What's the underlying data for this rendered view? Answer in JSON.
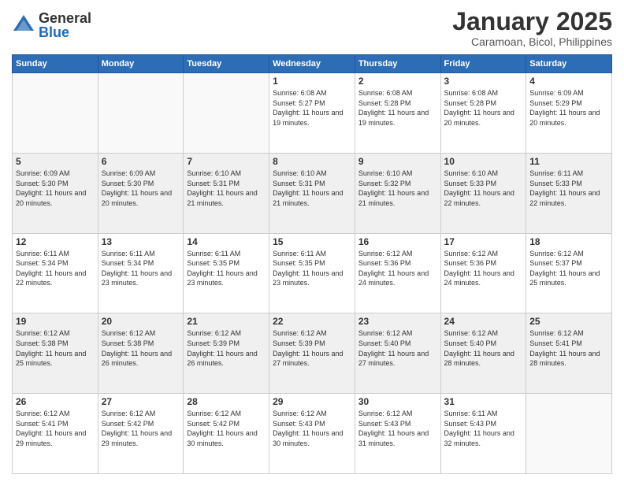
{
  "header": {
    "logo": {
      "line1": "General",
      "line2": "Blue"
    },
    "title": "January 2025",
    "location": "Caramoan, Bicol, Philippines"
  },
  "days_of_week": [
    "Sunday",
    "Monday",
    "Tuesday",
    "Wednesday",
    "Thursday",
    "Friday",
    "Saturday"
  ],
  "weeks": [
    [
      {
        "day": "",
        "sunrise": "",
        "sunset": "",
        "daylight": "",
        "empty": true
      },
      {
        "day": "",
        "sunrise": "",
        "sunset": "",
        "daylight": "",
        "empty": true
      },
      {
        "day": "",
        "sunrise": "",
        "sunset": "",
        "daylight": "",
        "empty": true
      },
      {
        "day": "1",
        "sunrise": "Sunrise: 6:08 AM",
        "sunset": "Sunset: 5:27 PM",
        "daylight": "Daylight: 11 hours and 19 minutes."
      },
      {
        "day": "2",
        "sunrise": "Sunrise: 6:08 AM",
        "sunset": "Sunset: 5:28 PM",
        "daylight": "Daylight: 11 hours and 19 minutes."
      },
      {
        "day": "3",
        "sunrise": "Sunrise: 6:08 AM",
        "sunset": "Sunset: 5:28 PM",
        "daylight": "Daylight: 11 hours and 20 minutes."
      },
      {
        "day": "4",
        "sunrise": "Sunrise: 6:09 AM",
        "sunset": "Sunset: 5:29 PM",
        "daylight": "Daylight: 11 hours and 20 minutes."
      }
    ],
    [
      {
        "day": "5",
        "sunrise": "Sunrise: 6:09 AM",
        "sunset": "Sunset: 5:30 PM",
        "daylight": "Daylight: 11 hours and 20 minutes."
      },
      {
        "day": "6",
        "sunrise": "Sunrise: 6:09 AM",
        "sunset": "Sunset: 5:30 PM",
        "daylight": "Daylight: 11 hours and 20 minutes."
      },
      {
        "day": "7",
        "sunrise": "Sunrise: 6:10 AM",
        "sunset": "Sunset: 5:31 PM",
        "daylight": "Daylight: 11 hours and 21 minutes."
      },
      {
        "day": "8",
        "sunrise": "Sunrise: 6:10 AM",
        "sunset": "Sunset: 5:31 PM",
        "daylight": "Daylight: 11 hours and 21 minutes."
      },
      {
        "day": "9",
        "sunrise": "Sunrise: 6:10 AM",
        "sunset": "Sunset: 5:32 PM",
        "daylight": "Daylight: 11 hours and 21 minutes."
      },
      {
        "day": "10",
        "sunrise": "Sunrise: 6:10 AM",
        "sunset": "Sunset: 5:33 PM",
        "daylight": "Daylight: 11 hours and 22 minutes."
      },
      {
        "day": "11",
        "sunrise": "Sunrise: 6:11 AM",
        "sunset": "Sunset: 5:33 PM",
        "daylight": "Daylight: 11 hours and 22 minutes."
      }
    ],
    [
      {
        "day": "12",
        "sunrise": "Sunrise: 6:11 AM",
        "sunset": "Sunset: 5:34 PM",
        "daylight": "Daylight: 11 hours and 22 minutes."
      },
      {
        "day": "13",
        "sunrise": "Sunrise: 6:11 AM",
        "sunset": "Sunset: 5:34 PM",
        "daylight": "Daylight: 11 hours and 23 minutes."
      },
      {
        "day": "14",
        "sunrise": "Sunrise: 6:11 AM",
        "sunset": "Sunset: 5:35 PM",
        "daylight": "Daylight: 11 hours and 23 minutes."
      },
      {
        "day": "15",
        "sunrise": "Sunrise: 6:11 AM",
        "sunset": "Sunset: 5:35 PM",
        "daylight": "Daylight: 11 hours and 23 minutes."
      },
      {
        "day": "16",
        "sunrise": "Sunrise: 6:12 AM",
        "sunset": "Sunset: 5:36 PM",
        "daylight": "Daylight: 11 hours and 24 minutes."
      },
      {
        "day": "17",
        "sunrise": "Sunrise: 6:12 AM",
        "sunset": "Sunset: 5:36 PM",
        "daylight": "Daylight: 11 hours and 24 minutes."
      },
      {
        "day": "18",
        "sunrise": "Sunrise: 6:12 AM",
        "sunset": "Sunset: 5:37 PM",
        "daylight": "Daylight: 11 hours and 25 minutes."
      }
    ],
    [
      {
        "day": "19",
        "sunrise": "Sunrise: 6:12 AM",
        "sunset": "Sunset: 5:38 PM",
        "daylight": "Daylight: 11 hours and 25 minutes."
      },
      {
        "day": "20",
        "sunrise": "Sunrise: 6:12 AM",
        "sunset": "Sunset: 5:38 PM",
        "daylight": "Daylight: 11 hours and 26 minutes."
      },
      {
        "day": "21",
        "sunrise": "Sunrise: 6:12 AM",
        "sunset": "Sunset: 5:39 PM",
        "daylight": "Daylight: 11 hours and 26 minutes."
      },
      {
        "day": "22",
        "sunrise": "Sunrise: 6:12 AM",
        "sunset": "Sunset: 5:39 PM",
        "daylight": "Daylight: 11 hours and 27 minutes."
      },
      {
        "day": "23",
        "sunrise": "Sunrise: 6:12 AM",
        "sunset": "Sunset: 5:40 PM",
        "daylight": "Daylight: 11 hours and 27 minutes."
      },
      {
        "day": "24",
        "sunrise": "Sunrise: 6:12 AM",
        "sunset": "Sunset: 5:40 PM",
        "daylight": "Daylight: 11 hours and 28 minutes."
      },
      {
        "day": "25",
        "sunrise": "Sunrise: 6:12 AM",
        "sunset": "Sunset: 5:41 PM",
        "daylight": "Daylight: 11 hours and 28 minutes."
      }
    ],
    [
      {
        "day": "26",
        "sunrise": "Sunrise: 6:12 AM",
        "sunset": "Sunset: 5:41 PM",
        "daylight": "Daylight: 11 hours and 29 minutes."
      },
      {
        "day": "27",
        "sunrise": "Sunrise: 6:12 AM",
        "sunset": "Sunset: 5:42 PM",
        "daylight": "Daylight: 11 hours and 29 minutes."
      },
      {
        "day": "28",
        "sunrise": "Sunrise: 6:12 AM",
        "sunset": "Sunset: 5:42 PM",
        "daylight": "Daylight: 11 hours and 30 minutes."
      },
      {
        "day": "29",
        "sunrise": "Sunrise: 6:12 AM",
        "sunset": "Sunset: 5:43 PM",
        "daylight": "Daylight: 11 hours and 30 minutes."
      },
      {
        "day": "30",
        "sunrise": "Sunrise: 6:12 AM",
        "sunset": "Sunset: 5:43 PM",
        "daylight": "Daylight: 11 hours and 31 minutes."
      },
      {
        "day": "31",
        "sunrise": "Sunrise: 6:11 AM",
        "sunset": "Sunset: 5:43 PM",
        "daylight": "Daylight: 11 hours and 32 minutes."
      },
      {
        "day": "",
        "sunrise": "",
        "sunset": "",
        "daylight": "",
        "empty": true
      }
    ]
  ]
}
